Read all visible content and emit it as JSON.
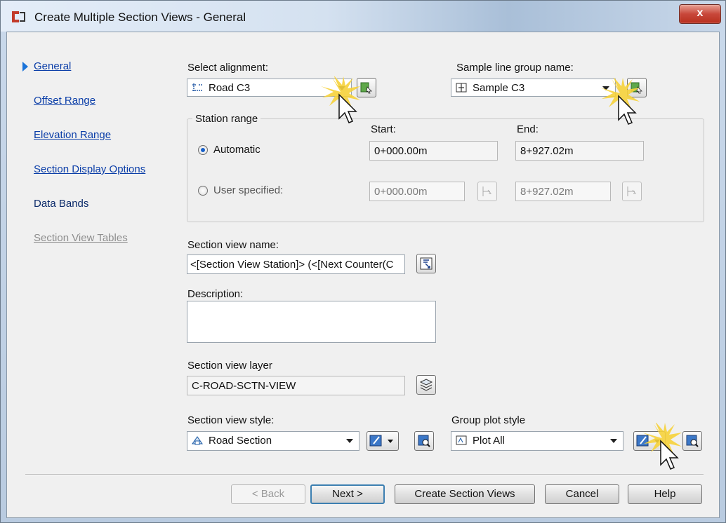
{
  "window": {
    "title": "Create Multiple Section Views - General",
    "close_label": "x"
  },
  "nav": {
    "items": [
      {
        "label": "General",
        "state": "selected"
      },
      {
        "label": "Offset Range",
        "state": "link"
      },
      {
        "label": "Elevation Range",
        "state": "link"
      },
      {
        "label": "Section Display Options",
        "state": "link"
      },
      {
        "label": "Data Bands",
        "state": "link"
      },
      {
        "label": "Section View Tables",
        "state": "disabled"
      }
    ]
  },
  "alignment": {
    "label": "Select alignment:",
    "value": "Road C3",
    "icon": "alignment-icon"
  },
  "sample_line_group": {
    "label": "Sample line group name:",
    "value": "Sample C3",
    "icon": "sample-line-icon"
  },
  "station_range": {
    "title": "Station range",
    "start_label": "Start:",
    "end_label": "End:",
    "automatic_label": "Automatic",
    "automatic_selected": true,
    "auto_start": "0+000.00m",
    "auto_end": "8+927.02m",
    "user_label": "User specified:",
    "user_start": "0+000.00m",
    "user_end": "8+927.02m"
  },
  "section_view_name": {
    "label": "Section view name:",
    "value": "<[Section View Station]> (<[Next Counter(C"
  },
  "description": {
    "label": "Description:",
    "value": ""
  },
  "section_view_layer": {
    "label": "Section view layer",
    "value": "C-ROAD-SCTN-VIEW"
  },
  "section_view_style": {
    "label": "Section view style:",
    "value": "Road Section"
  },
  "group_plot_style": {
    "label": "Group plot style",
    "value": "Plot All"
  },
  "buttons": {
    "back": "< Back",
    "next": "Next >",
    "create": "Create Section Views",
    "cancel": "Cancel",
    "help": "Help"
  },
  "colors": {
    "link": "#0b3ea8",
    "selected_marker": "#1a73d9",
    "highlight": "#f6d23a",
    "close_button": "#c8473a"
  }
}
